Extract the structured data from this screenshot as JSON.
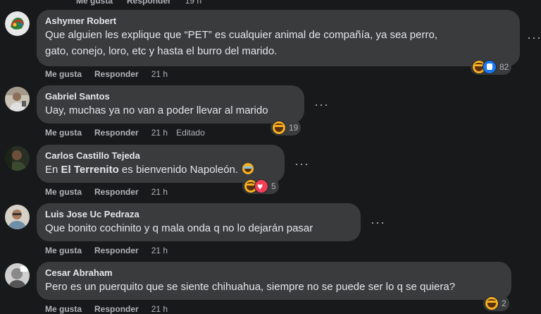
{
  "top_actions": {
    "like": "Me gusta",
    "reply": "Responder",
    "time": "19 h"
  },
  "comments": [
    {
      "author": "Ashymer Robert",
      "text_line1": "Que alguien les explique que “PET” es cualquier animal de compañía, ya sea perro,",
      "text_line2": "gato, conejo, loro, etc y hasta el burro del marido.",
      "like": "Me gusta",
      "reply": "Responder",
      "time": "21 h",
      "reaction_count": "82",
      "reactions": [
        "haha",
        "like"
      ]
    },
    {
      "author": "Gabriel Santos",
      "text": "Uay, muchas ya no van a poder llevar al marido",
      "like": "Me gusta",
      "reply": "Responder",
      "time": "21 h",
      "edited": "Editado",
      "reaction_count": "19",
      "reactions": [
        "haha"
      ]
    },
    {
      "author": "Carlos Castillo Tejeda",
      "text_pre": "En ",
      "text_bold": "El Terrenito",
      "text_post": " es bienvenido Napoleón.",
      "like": "Me gusta",
      "reply": "Responder",
      "time": "21 h",
      "reaction_count": "5",
      "reactions": [
        "haha",
        "love"
      ]
    },
    {
      "author": "Luis Jose Uc Pedraza",
      "text": "Que bonito cochinito y q mala onda q no lo dejarán pasar",
      "like": "Me gusta",
      "reply": "Responder",
      "time": "21 h"
    },
    {
      "author": "Cesar Abraham",
      "text": "Pero es un puerquito que se siente chihuahua, siempre no se puede ser lo q se quiera?",
      "like": "Me gusta",
      "reply": "Responder",
      "time": "21 h",
      "reaction_count": "2",
      "reactions": [
        "haha"
      ]
    }
  ],
  "icons": {
    "more": "more-options-icon",
    "haha": "haha-reaction-icon",
    "like": "like-reaction-icon",
    "love": "love-reaction-icon"
  },
  "colors": {
    "background": "#18191a",
    "bubble": "#3a3b3c",
    "text": "#e4e6eb",
    "muted": "#b0b3b8",
    "like_blue": "#1877f2",
    "love_red": "#f33e58",
    "haha_yellow": "#f7b125"
  }
}
